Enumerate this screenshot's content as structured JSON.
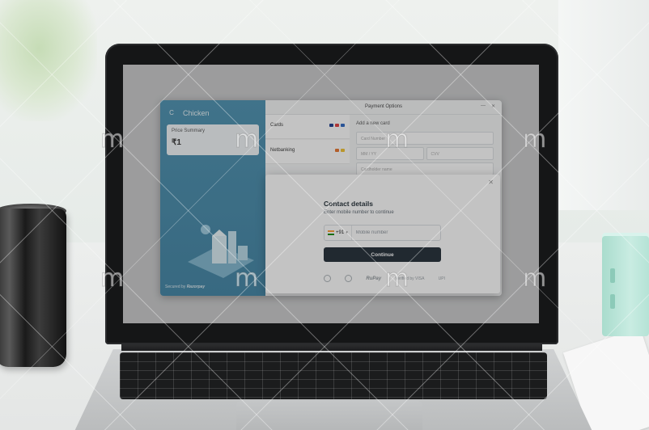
{
  "checkout": {
    "merchant_logo": "C",
    "merchant_name": "Chicken",
    "price_summary_label": "Price Summary",
    "price_value": "₹1",
    "secured_by": "Secured by",
    "secured_brand": "Razorpay",
    "header_title": "Payment Options",
    "methods": [
      {
        "label": "Cards"
      },
      {
        "label": "Netbanking"
      }
    ],
    "card_form": {
      "title": "Add a new card",
      "card_number_placeholder": "Card Number",
      "expiry_placeholder": "MM / YY",
      "cvv_placeholder": "CVV",
      "name_placeholder": "Cardholder name"
    }
  },
  "modal": {
    "title": "Contact details",
    "subtitle": "Enter mobile number to continue",
    "country_code": "+91",
    "mobile_placeholder": "Mobile number",
    "continue_label": "Continue",
    "trust_badges": [
      "RuPay",
      "Verified by VISA",
      "UPI"
    ]
  },
  "watermark": {
    "text": "m"
  },
  "colors": {
    "brand_blue": "#4a90b0",
    "button_dark": "#1f2a34",
    "flag_saffron": "#ff9933",
    "flag_green": "#138808"
  }
}
